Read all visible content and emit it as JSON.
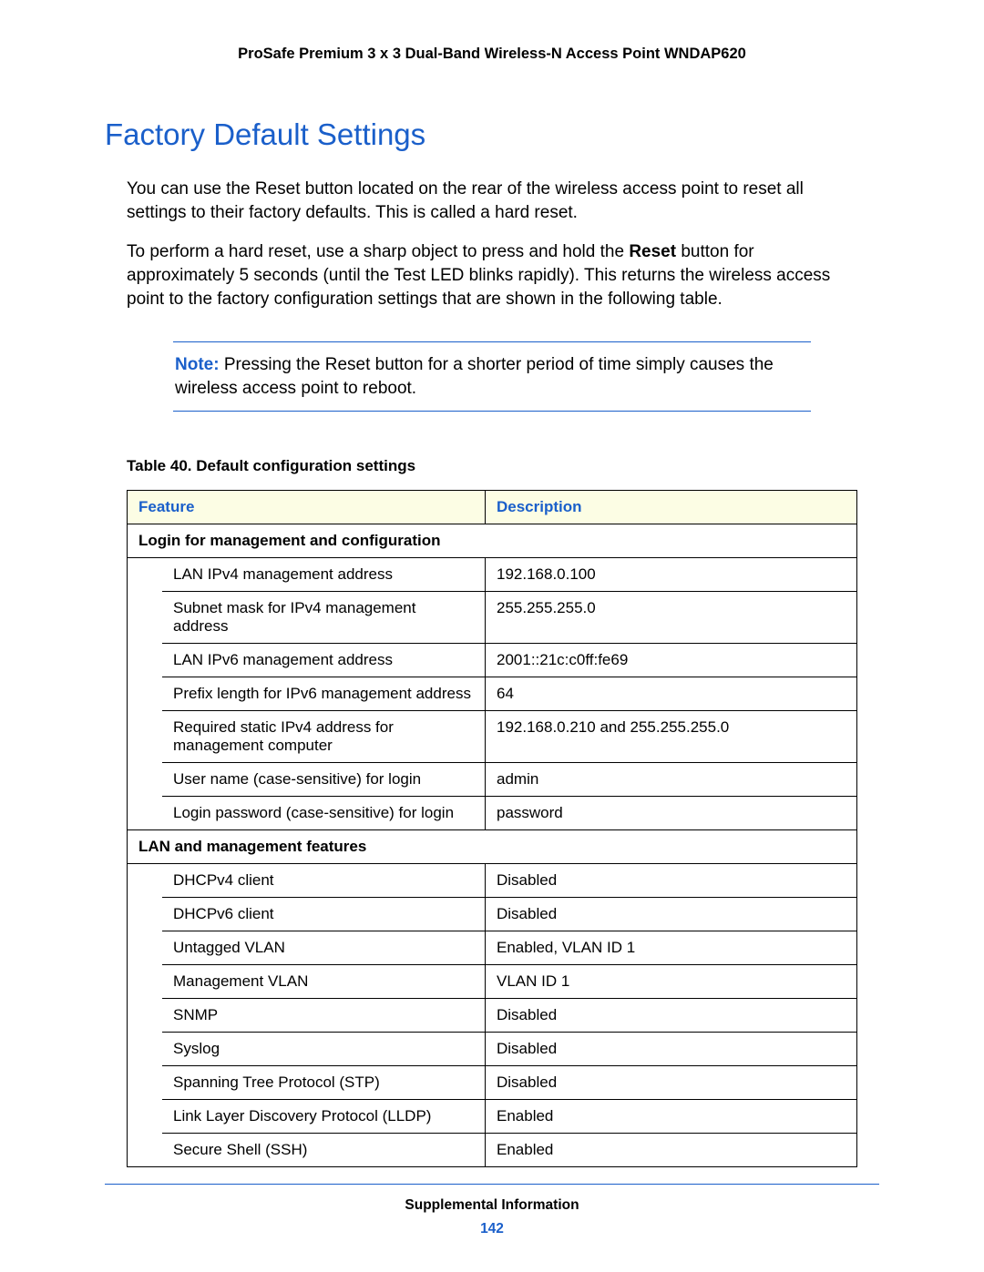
{
  "header": {
    "product": "ProSafe Premium 3 x 3 Dual-Band Wireless-N Access Point WNDAP620"
  },
  "section": {
    "title": "Factory Default Settings",
    "para1": "You can use the Reset button located on the rear of the wireless access point to reset all settings to their factory defaults. This is called a hard reset.",
    "para2_pre": "To perform a hard reset, use a sharp object to press and hold the ",
    "para2_bold": "Reset",
    "para2_post": " button for approximately 5 seconds (until the Test LED blinks rapidly). This returns the wireless access point to the factory configuration settings that are shown in the following table."
  },
  "note": {
    "label": "Note:",
    "text": " Pressing the Reset button for a shorter period of time simply causes the wireless access point to reboot."
  },
  "table": {
    "caption": "Table 40.  Default configuration settings",
    "headers": {
      "feature": "Feature",
      "description": "Description"
    },
    "sections": [
      {
        "title": "Login for management and configuration",
        "rows": [
          {
            "feature": "LAN IPv4 management address",
            "description": "192.168.0.100"
          },
          {
            "feature": "Subnet mask for IPv4 management address",
            "description": "255.255.255.0"
          },
          {
            "feature": "LAN IPv6 management address",
            "description": "2001::21c:c0ff:fe69"
          },
          {
            "feature": "Prefix length for IPv6 management address",
            "description": "64"
          },
          {
            "feature": "Required static IPv4 address for management computer",
            "description": "192.168.0.210 and 255.255.255.0"
          },
          {
            "feature": "User name (case-sensitive) for login",
            "description": "admin"
          },
          {
            "feature": "Login password (case-sensitive) for login",
            "description": "password"
          }
        ]
      },
      {
        "title": "LAN and management features",
        "rows": [
          {
            "feature": "DHCPv4 client",
            "description": "Disabled"
          },
          {
            "feature": "DHCPv6 client",
            "description": "Disabled"
          },
          {
            "feature": "Untagged VLAN",
            "description": "Enabled, VLAN ID 1"
          },
          {
            "feature": "Management VLAN",
            "description": "VLAN ID 1"
          },
          {
            "feature": "SNMP",
            "description": "Disabled"
          },
          {
            "feature": "Syslog",
            "description": "Disabled"
          },
          {
            "feature": "Spanning Tree Protocol (STP)",
            "description": "Disabled"
          },
          {
            "feature": "Link Layer Discovery Protocol (LLDP)",
            "description": "Enabled"
          },
          {
            "feature": "Secure Shell (SSH)",
            "description": "Enabled"
          }
        ]
      }
    ]
  },
  "footer": {
    "text": "Supplemental Information",
    "page": "142"
  }
}
